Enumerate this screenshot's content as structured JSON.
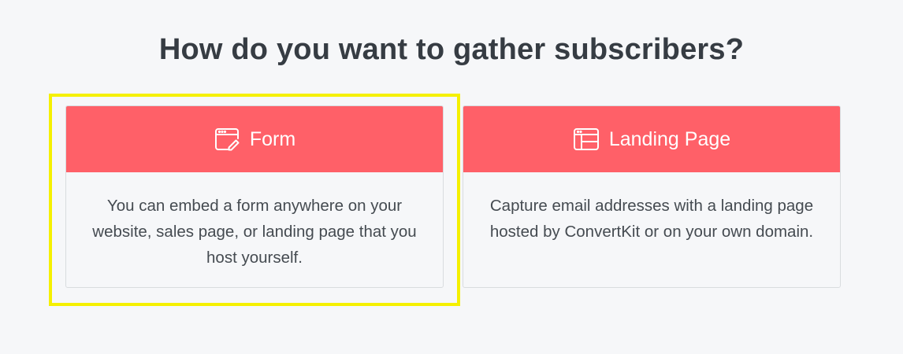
{
  "heading": "How do you want to gather subscribers?",
  "options": [
    {
      "label": "Form",
      "icon": "form-edit-icon",
      "description": "You can embed a form anywhere on your website, sales page, or landing page that you host yourself.",
      "highlighted": true
    },
    {
      "label": "Landing Page",
      "icon": "landing-page-layout-icon",
      "description": "Capture email addresses with a landing page hosted by ConvertKit or on your own domain.",
      "highlighted": false
    }
  ],
  "colors": {
    "background": "#f6f7f9",
    "header_accent": "#ff6068",
    "highlight_outline": "#f5f000",
    "heading_text": "#363c43"
  }
}
